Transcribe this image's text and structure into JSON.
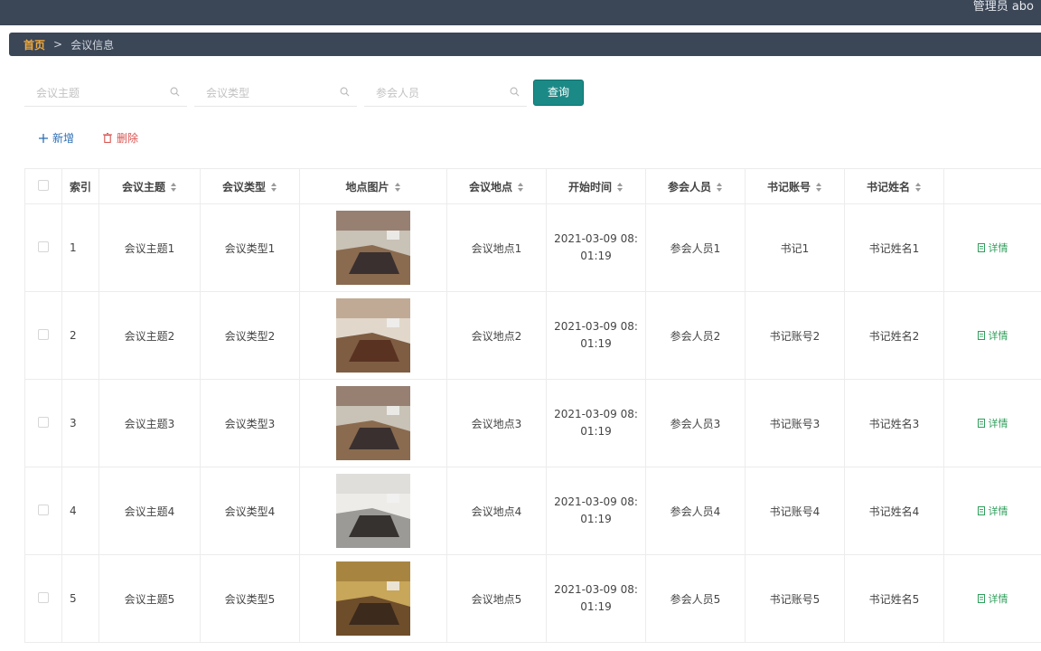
{
  "header": {
    "user": "管理员 abo"
  },
  "breadcrumb": {
    "home": "首页",
    "separator": ">",
    "current": "会议信息"
  },
  "search": {
    "topic_placeholder": "会议主题",
    "type_placeholder": "会议类型",
    "people_placeholder": "参会人员",
    "query_label": "查询"
  },
  "actions": {
    "add_label": "新增",
    "delete_label": "删除"
  },
  "table": {
    "columns": [
      "索引",
      "会议主题",
      "会议类型",
      "地点图片",
      "会议地点",
      "开始时间",
      "参会人员",
      "书记账号",
      "书记姓名"
    ],
    "detail_label": "详情",
    "rows": [
      {
        "index": "1",
        "topic": "会议主题1",
        "type": "会议类型1",
        "image": "conference-room-photo",
        "place": "会议地点1",
        "start": "2021-03-09 08:01:19",
        "people": "参会人员1",
        "account": "书记1",
        "name": "书记姓名1"
      },
      {
        "index": "2",
        "topic": "会议主题2",
        "type": "会议类型2",
        "image": "conference-room-photo",
        "place": "会议地点2",
        "start": "2021-03-09 08:01:19",
        "people": "参会人员2",
        "account": "书记账号2",
        "name": "书记姓名2"
      },
      {
        "index": "3",
        "topic": "会议主题3",
        "type": "会议类型3",
        "image": "conference-room-photo",
        "place": "会议地点3",
        "start": "2021-03-09 08:01:19",
        "people": "参会人员3",
        "account": "书记账号3",
        "name": "书记姓名3"
      },
      {
        "index": "4",
        "topic": "会议主题4",
        "type": "会议类型4",
        "image": "conference-room-photo",
        "place": "会议地点4",
        "start": "2021-03-09 08:01:19",
        "people": "参会人员4",
        "account": "书记账号4",
        "name": "书记姓名4"
      },
      {
        "index": "5",
        "topic": "会议主题5",
        "type": "会议类型5",
        "image": "conference-room-photo",
        "place": "会议地点5",
        "start": "2021-03-09 08:01:19",
        "people": "参会人员5",
        "account": "书记账号5",
        "name": "书记姓名5"
      }
    ]
  },
  "colors": {
    "topbar": "#3b4656",
    "accent": "#1b8a87",
    "crumb_home": "#f0a93c",
    "add": "#2d6fb5",
    "delete": "#d9534f",
    "detail": "#2f9e5b"
  },
  "icons": {
    "search": "search-icon",
    "add": "plus-icon",
    "delete": "trash-icon",
    "detail": "document-icon",
    "sort": "sort-icon"
  }
}
